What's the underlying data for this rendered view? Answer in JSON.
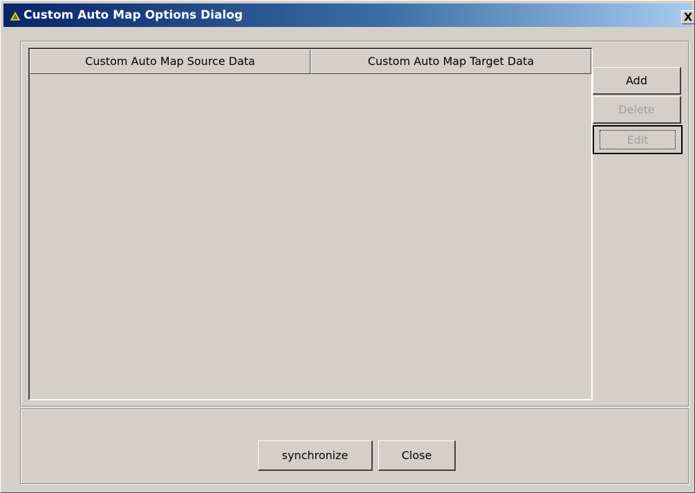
{
  "window": {
    "title": "Custom Auto Map Options Dialog",
    "title_icon": "app-triangle-icon",
    "close_label": "X"
  },
  "table": {
    "columns": [
      "Custom Auto Map Source Data",
      "Custom Auto Map Target Data"
    ],
    "rows": []
  },
  "side_buttons": {
    "add": "Add",
    "delete": "Delete",
    "edit": "Edit",
    "delete_enabled": false,
    "edit_enabled": false
  },
  "footer": {
    "synchronize": "synchronize",
    "close": "Close"
  },
  "colors": {
    "title_gradient_start": "#0a246a",
    "title_gradient_end": "#a6caf0",
    "face": "#d4d0c8",
    "disabled_text": "#a0a0a0"
  }
}
